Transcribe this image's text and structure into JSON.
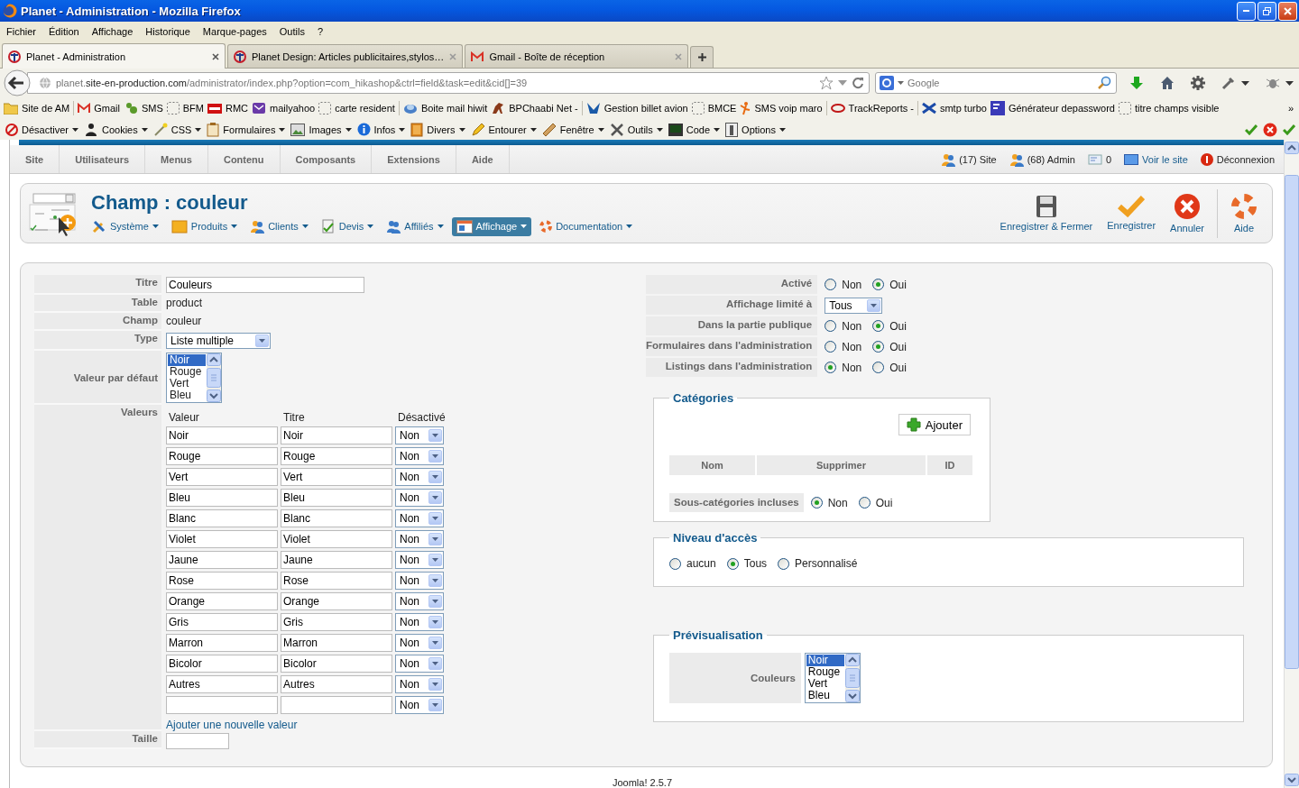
{
  "window": {
    "title": "Planet - Administration - Mozilla Firefox"
  },
  "menu_bar": [
    "Fichier",
    "Édition",
    "Affichage",
    "Historique",
    "Marque-pages",
    "Outils",
    "?"
  ],
  "tabs": [
    {
      "label": "Planet - Administration",
      "selected": true
    },
    {
      "label": "Planet Design: Articles publicitaires,stylos…",
      "selected": false
    },
    {
      "label": "Gmail - Boîte de réception",
      "selected": false
    }
  ],
  "address_bar": {
    "url_prefix": "planet.",
    "url_domain": "site-en-production.com",
    "url_path": "/administrator/index.php?option=com_hikashop&ctrl=field&task=edit&cid[]=39"
  },
  "search_field": {
    "placeholder": "Google"
  },
  "bookmarks": [
    "Site de AM",
    "Gmail",
    "SMS",
    "BFM",
    "RMC",
    "mailyahoo",
    "carte resident",
    "Boite mail hiwit",
    "BPChaabi Net -",
    "Gestion billet avion",
    "BMCE",
    "SMS voip maro",
    "TrackReports -",
    "smtp turbo",
    "Générateur depassword",
    "titre champs visible"
  ],
  "bookmarks_overflow": "»",
  "dev_toolbar": [
    "Désactiver",
    "Cookies",
    "CSS",
    "Formulaires",
    "Images",
    "Infos",
    "Divers",
    "Entourer",
    "Fenêtre",
    "Outils",
    "Code",
    "Options"
  ],
  "admin_menu": [
    "Site",
    "Utilisateurs",
    "Menus",
    "Contenu",
    "Composants",
    "Extensions",
    "Aide"
  ],
  "admin_status": [
    {
      "kind": "text",
      "label": "(17) Site"
    },
    {
      "kind": "text",
      "label": "(68) Admin"
    },
    {
      "kind": "text",
      "label": "0"
    },
    {
      "kind": "link",
      "label": "Voir le site"
    },
    {
      "kind": "text",
      "label": "Déconnexion"
    }
  ],
  "page_title": "Champ : couleur",
  "submenu": [
    {
      "label": "Système",
      "selected": false
    },
    {
      "label": "Produits",
      "selected": false
    },
    {
      "label": "Clients",
      "selected": false
    },
    {
      "label": "Devis",
      "selected": false
    },
    {
      "label": "Affiliés",
      "selected": false
    },
    {
      "label": "Affichage",
      "selected": true
    },
    {
      "label": "Documentation",
      "selected": false
    }
  ],
  "toolbar": [
    "Enregistrer & Fermer",
    "Enregistrer",
    "Annuler",
    "Aide"
  ],
  "left_rows": [
    {
      "kind": "input",
      "label": "Titre",
      "value": "Couleurs"
    },
    {
      "kind": "text",
      "label": "Table",
      "value": "product"
    },
    {
      "kind": "text",
      "label": "Champ",
      "value": "couleur"
    },
    {
      "kind": "select",
      "label": "Type",
      "value": "Liste multiple"
    },
    {
      "kind": "listbox",
      "label": "Valeur par défaut",
      "options": [
        {
          "label": "Noir",
          "selected": true
        },
        {
          "label": "Rouge",
          "selected": false
        },
        {
          "label": "Vert",
          "selected": false
        },
        {
          "label": "Bleu",
          "selected": false
        }
      ]
    },
    {
      "kind": "values",
      "label": "Valeurs",
      "columns": [
        "Valeur",
        "Titre",
        "Désactivé"
      ],
      "rows": [
        {
          "value": "Noir",
          "title": "Noir",
          "disabled": "Non"
        },
        {
          "value": "Rouge",
          "title": "Rouge",
          "disabled": "Non"
        },
        {
          "value": "Vert",
          "title": "Vert",
          "disabled": "Non"
        },
        {
          "value": "Bleu",
          "title": "Bleu",
          "disabled": "Non"
        },
        {
          "value": "Blanc",
          "title": "Blanc",
          "disabled": "Non"
        },
        {
          "value": "Violet",
          "title": "Violet",
          "disabled": "Non"
        },
        {
          "value": "Jaune",
          "title": "Jaune",
          "disabled": "Non"
        },
        {
          "value": "Rose",
          "title": "Rose",
          "disabled": "Non"
        },
        {
          "value": "Orange",
          "title": "Orange",
          "disabled": "Non"
        },
        {
          "value": "Gris",
          "title": "Gris",
          "disabled": "Non"
        },
        {
          "value": "Marron",
          "title": "Marron",
          "disabled": "Non"
        },
        {
          "value": "Bicolor",
          "title": "Bicolor",
          "disabled": "Non"
        },
        {
          "value": "Autres",
          "title": "Autres",
          "disabled": "Non"
        },
        {
          "disabled": "Non"
        }
      ],
      "add_link": "Ajouter une nouvelle valeur"
    },
    {
      "kind": "input",
      "label": "Taille"
    }
  ],
  "right_rows": [
    {
      "kind": "radio",
      "label": "Activé",
      "options": [
        {
          "label": "Non",
          "selected": false
        },
        {
          "label": "Oui",
          "selected": true
        }
      ]
    },
    {
      "kind": "select",
      "label": "Affichage limité à",
      "value": "Tous"
    },
    {
      "kind": "radio",
      "label": "Dans la partie publique",
      "options": [
        {
          "label": "Non",
          "selected": false
        },
        {
          "label": "Oui",
          "selected": true
        }
      ]
    },
    {
      "kind": "radio",
      "label": "Formulaires dans l'administration",
      "options": [
        {
          "label": "Non",
          "selected": false
        },
        {
          "label": "Oui",
          "selected": true
        }
      ]
    },
    {
      "kind": "radio",
      "label": "Listings dans l'administration",
      "options": [
        {
          "label": "Non",
          "selected": true
        },
        {
          "label": "Oui",
          "selected": false
        }
      ]
    }
  ],
  "categories": {
    "legend": "Catégories",
    "add_button": "Ajouter",
    "columns": [
      "Nom",
      "Supprimer",
      "ID"
    ],
    "subcategories": {
      "label": "Sous-catégories incluses",
      "options": [
        {
          "label": "Non",
          "selected": true
        },
        {
          "label": "Oui",
          "selected": false
        }
      ]
    }
  },
  "access": {
    "legend": "Niveau d'accès",
    "options": [
      {
        "label": "aucun",
        "selected": false
      },
      {
        "label": "Tous",
        "selected": true
      },
      {
        "label": "Personnalisé",
        "selected": false
      }
    ]
  },
  "preview": {
    "legend": "Prévisualisation",
    "label": "Couleurs",
    "options": [
      {
        "label": "Noir",
        "selected": true
      },
      {
        "label": "Rouge",
        "selected": false
      },
      {
        "label": "Vert",
        "selected": false
      },
      {
        "label": "Bleu",
        "selected": false
      }
    ]
  },
  "footer": "Joomla! 2.5.7"
}
